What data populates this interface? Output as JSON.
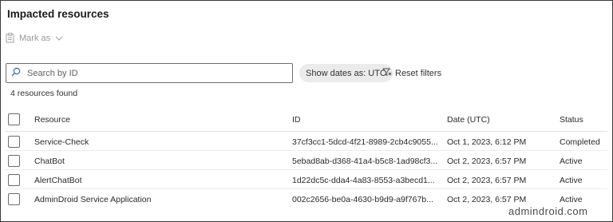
{
  "panel": {
    "title": "Impacted resources"
  },
  "toolbar": {
    "mark_as_label": "Mark as"
  },
  "search": {
    "placeholder": "Search by ID"
  },
  "filters": {
    "show_dates_label": "Show dates as: UTC",
    "reset_label": "Reset filters"
  },
  "results": {
    "count_text": "4 resources found"
  },
  "table": {
    "headers": {
      "resource": "Resource",
      "id": "ID",
      "date": "Date (UTC)",
      "status": "Status"
    },
    "rows": [
      {
        "resource": "Service-Check",
        "id": "37cf3cc1-5dcd-4f21-8989-2cb4c9055...",
        "date": "Oct 1, 2023, 6:12 PM",
        "status": "Completed"
      },
      {
        "resource": "ChatBot",
        "id": "5ebad8ab-d368-41a4-b5c8-1ad98cf3...",
        "date": "Oct 2, 2023, 6:57 PM",
        "status": "Active"
      },
      {
        "resource": "AlertChatBot",
        "id": "1d22dc5c-dda4-4a83-8553-a3becd1...",
        "date": "Oct 2, 2023, 6:57 PM",
        "status": "Active"
      },
      {
        "resource": "AdminDroid Service Application",
        "id": "002c2656-be0a-4630-b9d9-a9f767b...",
        "date": "Oct 2, 2023, 6:57 PM",
        "status": "Active"
      }
    ]
  },
  "watermark": {
    "text": "admindroid.com"
  }
}
